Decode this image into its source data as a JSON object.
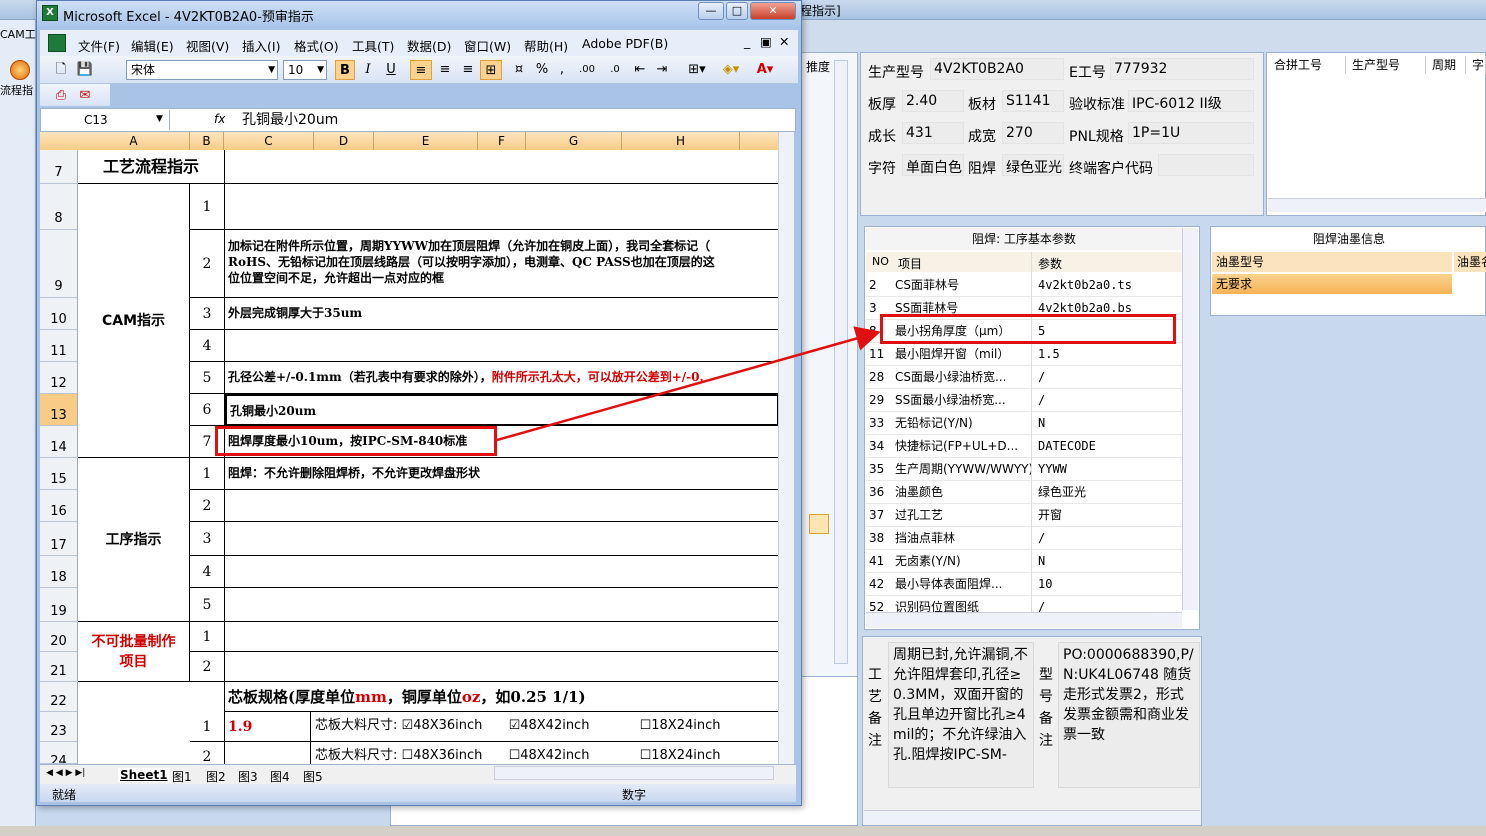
{
  "background_app": {
    "title_fragment": "程指示]",
    "left_tab": "CAM工程",
    "left_label": "流程指",
    "mid_header": "推度"
  },
  "excel": {
    "title": "Microsoft Excel - 4V2KT0B2A0-预审指示",
    "menu": [
      "文件(F)",
      "编辑(E)",
      "视图(V)",
      "插入(I)",
      "格式(O)",
      "工具(T)",
      "数据(D)",
      "窗口(W)",
      "帮助(H)",
      "Adobe PDF(B)"
    ],
    "font": "宋体",
    "font_size": "10",
    "name_box": "C13",
    "fx": "fx",
    "formula": "孔铜最小20um",
    "columns": [
      "A",
      "B",
      "C",
      "D",
      "E",
      "F",
      "G",
      "H"
    ],
    "rows": {
      "r7": "7",
      "r8": "8",
      "r9": "9",
      "r10": "10",
      "r11": "11",
      "r12": "12",
      "r13": "13",
      "r14": "14",
      "r15": "15",
      "r16": "16",
      "r17": "17",
      "r18": "18",
      "r19": "19",
      "r20": "20",
      "r21": "21",
      "r22": "22",
      "r23": "23",
      "r24": "24"
    },
    "sections": {
      "process": "工艺流程指示",
      "cam": "CAM指示",
      "step": "工序指示",
      "no_mass_line1": "不可批量制作",
      "no_mass_line2": "项目"
    },
    "nums": {
      "n1": "1",
      "n2": "2",
      "n3": "3",
      "n4": "4",
      "n5": "5",
      "n6": "6",
      "n7": "7"
    },
    "cam_items": {
      "i2_l1": "加标记在附件所示位置，周期YYWW加在顶层阻焊（允许加在铜皮上面），我司全套标记（",
      "i2_l2": "RoHS、无铅标记加在顶层线路层（可以按明字添加），电测章、QC PASS也加在顶层的这",
      "i2_l3": "位位置空间不足，允许超出一点对应的框",
      "i3": "外层完成铜厚大于35um",
      "i5_a": "孔径公差+/-0.1mm（若孔表中有要求的除外），",
      "i5_b": "附件所示孔太大，可以放开公差到+/-0.",
      "i6": "孔铜最小20um",
      "i7": "阻焊厚度最小10um，按IPC-SM-840标准"
    },
    "step_items": {
      "s1": "阻焊：不允许删除阻焊桥，不允许更改焊盘形状"
    },
    "core": {
      "header_a": "芯板规格(厚度单位",
      "header_b": "mm",
      "header_c": "，铜厚单位",
      "header_d": "oz",
      "header_e": "，如0.25 1/1)",
      "r23_val": "1.9",
      "size_label": "芯板大料尺寸:",
      "opt1": "48X36inch",
      "opt2": "48X42inch",
      "opt3": "18X24inch",
      "check_on": "☑",
      "check_off": "☐"
    },
    "sheet_nav": "◀ ◀ ▶ ▶|",
    "sheets": [
      "Sheet1",
      "图1",
      "图2",
      "图3",
      "图4",
      "图5"
    ],
    "status": "就绪",
    "status_num": "数字"
  },
  "info": {
    "model_label": "生产型号",
    "model": "4V2KT0B2A0",
    "eno_label": "E工号",
    "eno": "777932",
    "thick_label": "板厚",
    "thick": "2.40",
    "mat_label": "板材",
    "mat": "S1141",
    "std_label": "验收标准",
    "std": "IPC-6012 II级",
    "len_label": "成长",
    "len": "431",
    "wid_label": "成宽",
    "wid": "270",
    "pnl_label": "PNL规格",
    "pnl": "1P=1U",
    "char_label": "字符",
    "char": "单面白色",
    "mask_label": "阻焊",
    "mask": "绿色亚光",
    "cust_label": "终端客户代码",
    "cust": ""
  },
  "merge_headers": [
    "合拼工号",
    "生产型号",
    "周期",
    "字"
  ],
  "param": {
    "title": "阻焊: 工序基本参数",
    "h_no": "NO",
    "h_item": "项目",
    "h_val": "参数",
    "rows": [
      {
        "no": "2",
        "item": "CS面菲林号",
        "val": "4v2kt0b2a0.ts"
      },
      {
        "no": "3",
        "item": "SS面菲林号",
        "val": "4v2kt0b2a0.bs"
      },
      {
        "no": "8",
        "item": "最小拐角厚度（μm）",
        "val": "5"
      },
      {
        "no": "11",
        "item": "最小阻焊开窗（mil）",
        "val": "1.5"
      },
      {
        "no": "28",
        "item": "CS面最小绿油桥宽...",
        "val": "/"
      },
      {
        "no": "29",
        "item": "SS面最小绿油桥宽...",
        "val": "/"
      },
      {
        "no": "33",
        "item": "无铅标记(Y/N)",
        "val": "N"
      },
      {
        "no": "34",
        "item": "快捷标记(FP+UL+D...",
        "val": "DATECODE"
      },
      {
        "no": "35",
        "item": "生产周期(YYWW/WWYY)",
        "val": "YYWW"
      },
      {
        "no": "36",
        "item": "油墨颜色",
        "val": "绿色亚光"
      },
      {
        "no": "37",
        "item": "过孔工艺",
        "val": "开窗"
      },
      {
        "no": "38",
        "item": "挡油点菲林",
        "val": "/"
      },
      {
        "no": "41",
        "item": "无卤素(Y/N)",
        "val": "N"
      },
      {
        "no": "42",
        "item": "最小导体表面阻焊...",
        "val": "10"
      },
      {
        "no": "52",
        "item": "识别码位置图纸",
        "val": "/"
      }
    ]
  },
  "oil": {
    "title": "阻焊油墨信息",
    "h1": "油墨型号",
    "h2": "油墨名",
    "row": "无要求"
  },
  "remarks": {
    "proc_label": "工艺备注",
    "proc_text": "周期已封,允许漏铜,不允许阻焊套印,孔径≥0.3MM，双面开窗的孔且单边开窗比孔≥4mil的；不允许绿油入孔.阻焊按IPC-SM-",
    "model_label": "型号备注",
    "model_text": "PO:0000688390,P/N:UK4L06748 随货走形式发票2，形式发票金额需和商业发票一致"
  },
  "colors": {
    "highlight": "#e01010",
    "col_header": "#f8cc86",
    "red_text": "#d00000"
  }
}
